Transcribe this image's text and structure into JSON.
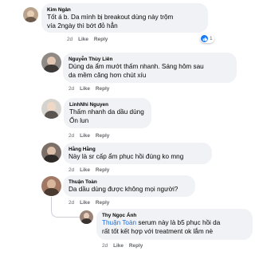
{
  "colors": {
    "bubble": "#f0f2f5",
    "meta_text": "#65676b",
    "mention": "#216fdb",
    "like_blue": "#1877f2"
  },
  "comments": [
    {
      "author": "Kim Ngân",
      "lines": [
        "Tốt á b. Da mình bị breakout dùng này trộm",
        "vía 2ngày thì bớt đỏ hẳn"
      ],
      "age": "2d",
      "like": "Like",
      "reply": "Reply",
      "reaction_count": "1",
      "reaction_icon": "like-icon"
    },
    {
      "author": "Nguyễn Thùy Liên",
      "lines": [
        "Dùng da ẩm mướt thấm nhanh. Sáng hôm sau",
        "da mềm căng hơn chút xíu"
      ],
      "age": "2d",
      "like": "Like",
      "reply": "Reply"
    },
    {
      "author": "LinhNhi Nguyen",
      "lines": [
        "Thấm nhanh da dầu dùng",
        "Ổn lun"
      ],
      "age": "2d",
      "like": "Like",
      "reply": "Reply"
    },
    {
      "author": "Hằng Hằng",
      "lines": [
        "Này là sr cấp ẩm phục hồi đúng ko mng"
      ],
      "age": "2d",
      "like": "Like",
      "reply": "Reply"
    },
    {
      "author": "Thuận Toàn",
      "lines": [
        "Da dầu dùng được không mọi người?"
      ],
      "age": "2d",
      "like": "Like",
      "reply": "Reply"
    }
  ],
  "reply": {
    "author": "Thy Ngọc Ánh",
    "mention": "Thuận Toàn",
    "line1_rest": " serum này là b5 phục hồi da",
    "line2": "rất tốt kết hợp với treatment ok lắm nè",
    "age": "2d",
    "like": "Like",
    "reply": "Reply"
  }
}
